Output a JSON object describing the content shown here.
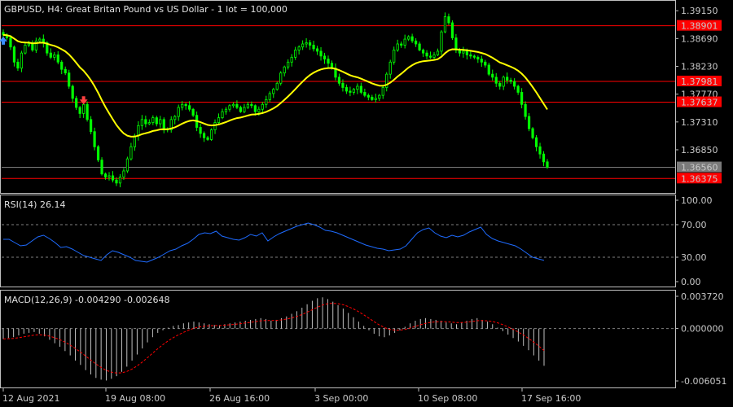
{
  "colors": {
    "background": "#000000",
    "border": "#c0c0c0",
    "bull_candle": "#00ff00",
    "bear_candle": "#00ff00",
    "ma_line": "#ffff00",
    "horizontal_lines": "#ff0000",
    "price_label_bg": "#ff0000",
    "current_price_bg": "#7a7a7a",
    "rsi_line": "#1e6bff",
    "macd_histogram": "#c0c0c0",
    "macd_signal": "#ff0000",
    "level_dotted": "#808080"
  },
  "main_panel": {
    "title": "GBPUSD, H4:  Great Britan Pound vs US Dollar - 1 lot = 100,000",
    "y_ticks": [
      "1.39150",
      "1.38690",
      "1.38230",
      "1.37770",
      "1.37310",
      "1.36850"
    ],
    "h_lines": [
      "1.38901",
      "1.37981",
      "1.37637",
      "1.36375"
    ],
    "current_price": "1.36560",
    "arrow_up_icon": "blue-up-arrow",
    "arrow_down_icon": "red-down-arrow"
  },
  "rsi_panel": {
    "title": "RSI(14) 26.14",
    "y_ticks": [
      "100.00",
      "70.00",
      "30.00",
      "0.00"
    ]
  },
  "macd_panel": {
    "title": "MACD(12,26,9) -0.004290 -0.002648",
    "y_ticks": [
      "0.003720",
      "0.000000",
      "-0.006051"
    ]
  },
  "x_ticks": [
    "12 Aug 2021",
    "19 Aug 08:00",
    "26 Aug 16:00",
    "3 Sep 00:00",
    "10 Sep 08:00",
    "17 Sep 16:00"
  ],
  "chart_data": [
    {
      "type": "candlestick",
      "title": "GBPUSD, H4:  Great Britan Pound vs US Dollar - 1 lot = 100,000",
      "ylim": [
        1.3615,
        1.393
      ],
      "x_ticks": [
        "12 Aug 2021",
        "19 Aug 08:00",
        "26 Aug 16:00",
        "3 Sep 00:00",
        "10 Sep 08:00",
        "17 Sep 16:00"
      ],
      "close_series": [
        1.3875,
        1.387,
        1.3855,
        1.383,
        1.382,
        1.3845,
        1.3858,
        1.386,
        1.385,
        1.3865,
        1.3868,
        1.3862,
        1.3845,
        1.3838,
        1.3842,
        1.383,
        1.3818,
        1.3812,
        1.379,
        1.377,
        1.3755,
        1.3745,
        1.376,
        1.3735,
        1.3715,
        1.369,
        1.3668,
        1.3645,
        1.364,
        1.3642,
        1.3635,
        1.363,
        1.364,
        1.365,
        1.367,
        1.369,
        1.3708,
        1.3725,
        1.3735,
        1.3728,
        1.373,
        1.3738,
        1.3728,
        1.3735,
        1.372,
        1.3718,
        1.3735,
        1.374,
        1.3755,
        1.376,
        1.3758,
        1.3752,
        1.3742,
        1.3722,
        1.3712,
        1.3705,
        1.3702,
        1.3718,
        1.373,
        1.3738,
        1.3748,
        1.3752,
        1.3758,
        1.376,
        1.3755,
        1.3748,
        1.3755,
        1.376,
        1.3758,
        1.3748,
        1.3752,
        1.376,
        1.3768,
        1.3778,
        1.3785,
        1.3795,
        1.3812,
        1.3822,
        1.383,
        1.3838,
        1.385,
        1.3855,
        1.386,
        1.3862,
        1.3858,
        1.3852,
        1.3848,
        1.384,
        1.3835,
        1.3828,
        1.382,
        1.3805,
        1.3795,
        1.3788,
        1.3782,
        1.378,
        1.3785,
        1.379,
        1.378,
        1.3775,
        1.3772,
        1.3768,
        1.377,
        1.3775,
        1.3788,
        1.381,
        1.383,
        1.385,
        1.386,
        1.3858,
        1.3868,
        1.3872,
        1.3865,
        1.386,
        1.385,
        1.3845,
        1.384,
        1.3838,
        1.3842,
        1.3848,
        1.388,
        1.3905,
        1.3895,
        1.387,
        1.385,
        1.3845,
        1.3848,
        1.3842,
        1.384,
        1.3838,
        1.3835,
        1.383,
        1.3825,
        1.381,
        1.3805,
        1.3795,
        1.379,
        1.3805,
        1.38,
        1.3798,
        1.379,
        1.378,
        1.376,
        1.374,
        1.372,
        1.3705,
        1.369,
        1.3678,
        1.3665,
        1.3656
      ],
      "h_lines": [
        1.38901,
        1.37981,
        1.37637,
        1.36375
      ],
      "current_price": 1.3656,
      "moving_average": "yellow"
    },
    {
      "type": "line",
      "title": "RSI(14) 26.14",
      "ylim": [
        0,
        100
      ],
      "levels": [
        70,
        30
      ],
      "values": [
        52,
        52,
        48,
        44,
        45,
        50,
        55,
        57,
        53,
        48,
        42,
        43,
        40,
        36,
        32,
        30,
        28,
        26,
        33,
        38,
        36,
        33,
        30,
        26,
        25,
        24,
        27,
        30,
        34,
        38,
        40,
        44,
        47,
        52,
        58,
        60,
        59,
        62,
        56,
        54,
        52,
        51,
        54,
        58,
        56,
        60,
        50,
        55,
        59,
        62,
        65,
        68,
        70,
        72,
        70,
        67,
        63,
        62,
        60,
        57,
        54,
        51,
        48,
        45,
        43,
        41,
        40,
        38,
        39,
        40,
        44,
        52,
        60,
        64,
        66,
        60,
        56,
        54,
        57,
        55,
        57,
        61,
        64,
        67,
        58,
        53,
        50,
        48,
        46,
        44,
        40,
        35,
        30,
        28,
        26.14
      ],
      "value": 26.14
    },
    {
      "type": "bar",
      "title": "MACD(12,26,9) -0.004290 -0.002648",
      "ylim": [
        -0.006051,
        0.00372
      ],
      "macd": -0.00429,
      "signal": -0.002648,
      "values": [
        -0.0012,
        -0.0011,
        -0.001,
        -0.0008,
        -0.0006,
        -0.0005,
        -0.0004,
        -0.0006,
        -0.0009,
        -0.0013,
        -0.0017,
        -0.0021,
        -0.0026,
        -0.0031,
        -0.0037,
        -0.0042,
        -0.0048,
        -0.0053,
        -0.0057,
        -0.0059,
        -0.006,
        -0.0058,
        -0.0055,
        -0.005,
        -0.0044,
        -0.0037,
        -0.003,
        -0.0023,
        -0.0016,
        -0.001,
        -0.0005,
        -0.0002,
        0.0001,
        0.0003,
        0.0004,
        0.0006,
        0.0007,
        0.0008,
        0.0007,
        0.0006,
        0.0005,
        0.0004,
        0.0004,
        0.0005,
        0.0006,
        0.0007,
        0.0008,
        0.0009,
        0.001,
        0.0011,
        0.0012,
        0.0011,
        0.0009,
        0.001,
        0.0012,
        0.0014,
        0.0017,
        0.002,
        0.0024,
        0.0028,
        0.0032,
        0.0035,
        0.0036,
        0.0034,
        0.0031,
        0.0027,
        0.0023,
        0.0018,
        0.0013,
        0.0008,
        0.0003,
        -0.0002,
        -0.0006,
        -0.0009,
        -0.001,
        -0.0008,
        -0.0005,
        -0.0002,
        0.0002,
        0.0006,
        0.0009,
        0.0011,
        0.0012,
        0.0011,
        0.001,
        0.0009,
        0.0007,
        0.0006,
        0.0005,
        0.0007,
        0.0009,
        0.0011,
        0.0012,
        0.001,
        0.0008,
        0.0005,
        0.0001,
        -0.0003,
        -0.0007,
        -0.0011,
        -0.0015,
        -0.002,
        -0.0025,
        -0.0031,
        -0.0037,
        -0.0043
      ]
    }
  ]
}
